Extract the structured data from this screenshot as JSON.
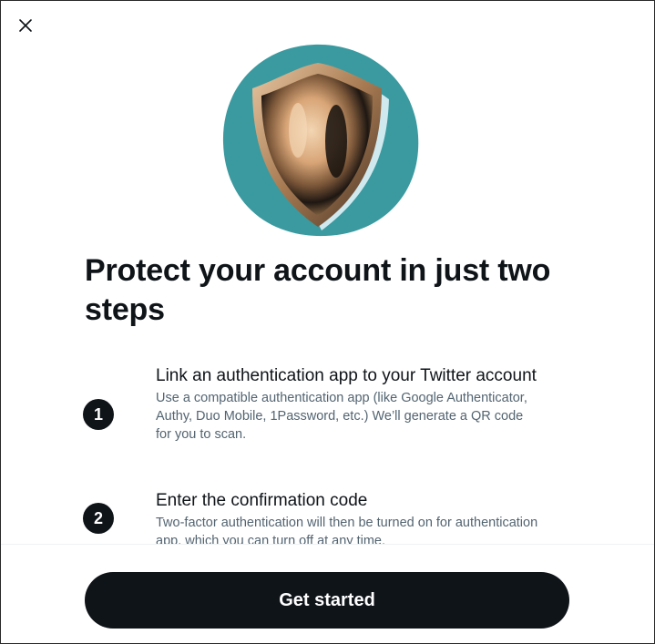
{
  "dialog": {
    "close_icon": "close-icon",
    "hero_icon": "shield-icon",
    "title": "Protect your account in just two steps",
    "steps": [
      {
        "number": "1",
        "title": "Link an authentication app to your Twitter account",
        "description": "Use a compatible authentication app (like Google Authenticator, Authy, Duo Mobile, 1Password, etc.) We’ll generate a QR code for you to scan."
      },
      {
        "number": "2",
        "title": "Enter the confirmation code",
        "description": "Two-factor authentication will then be turned on for authentication app, which you can turn off at any time."
      }
    ],
    "cta_label": "Get started"
  },
  "colors": {
    "text_primary": "#0f1419",
    "text_secondary": "#536471",
    "button_bg": "#0f1419",
    "hero_circle": "#3a9a9f",
    "shield_metal": "#c99a6e"
  }
}
